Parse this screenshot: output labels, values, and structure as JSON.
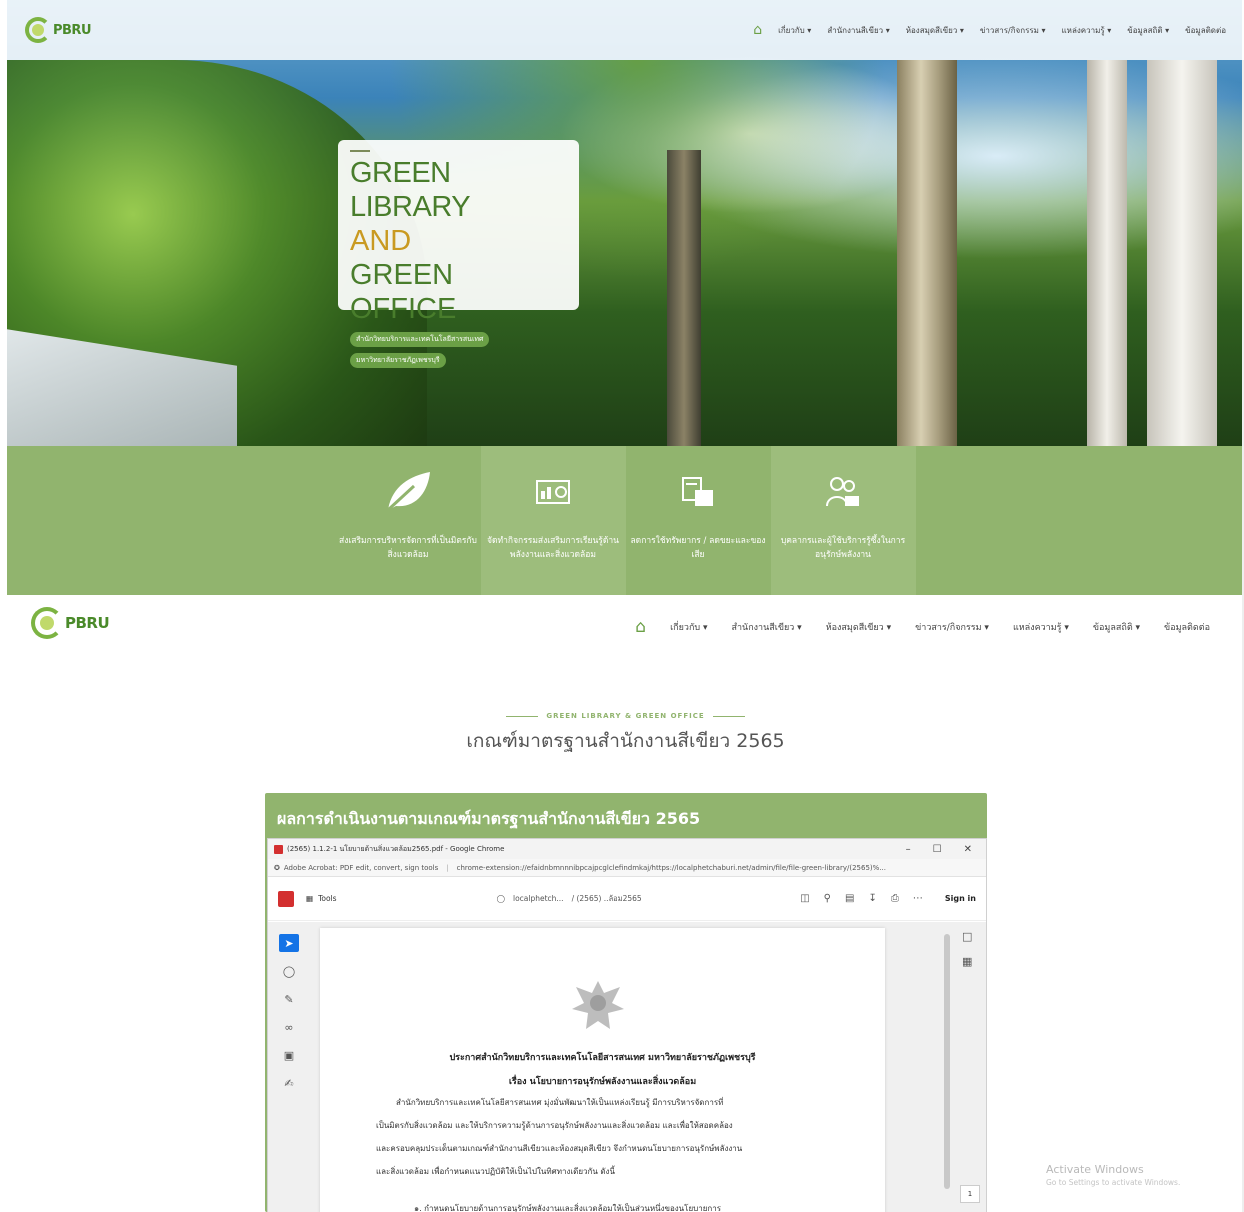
{
  "brand": {
    "logo_text": "PBRU"
  },
  "nav": {
    "items": [
      "เกี่ยวกับ ▾",
      "สำนักงานสีเขียว ▾",
      "ห้องสมุดสีเขียว ▾",
      "ข่าวสาร/กิจกรรม ▾",
      "แหล่งความรู้ ▾",
      "ข้อมูลสถิติ ▾",
      "ข้อมูลติดต่อ"
    ]
  },
  "hero": {
    "line1": "GREEN LIBRARY",
    "line2": "AND",
    "line3": "GREEN OFFICE",
    "pill1": "สำนักวิทยบริการและเทคโนโลยีสารสนเทศ",
    "pill2": "มหาวิทยาลัยราชภัฏเพชรบุรี"
  },
  "features": [
    {
      "icon": "leaf-icon",
      "label": "ส่งเสริมการบริหารจัดการที่เป็นมิตรกับสิ่งแวดล้อม"
    },
    {
      "icon": "activity-board-icon",
      "label": "จัดทำกิจกรรมส่งเสริมการเรียนรู้ด้านพลังงานและสิ่งแวดล้อม"
    },
    {
      "icon": "resource-reduction-icon",
      "label": "ลดการใช้ทรัพยากร / ลดขยะและของเสีย"
    },
    {
      "icon": "people-icon",
      "label": "บุคลากรและผู้ใช้บริการรู้ซึ้งในการอนุรักษ์พลังงาน"
    }
  ],
  "section": {
    "eyebrow": "GREEN LIBRARY & GREEN OFFICE",
    "title": "เกณฑ์มาตรฐานสำนักงานสีเขียว 2565"
  },
  "panel": {
    "title": "ผลการดำเนินงานตามเกณฑ์มาตรฐานสำนักงานสีเขียว 2565"
  },
  "chrome": {
    "window_title": "(2565) 1.1.2-1 นโยบายด้านสิ่งแวดล้อม2565.pdf - Google Chrome",
    "ext_name": "Adobe Acrobat: PDF edit, convert, sign tools",
    "url": "chrome-extension://efaidnbmnnnibpcajpcglclefindmkaj/https://localphetchaburi.net/admin/file/file-green-library/(2565)%...",
    "tools_label": "Tools",
    "host": "localphetch...",
    "file_short": "/  (2565) ..ล้อม2565",
    "sign_in": "Sign in",
    "page_number": "1"
  },
  "doc": {
    "heading": "ประกาศสำนักวิทยบริการและเทคโนโลยีสารสนเทศ มหาวิทยาลัยราชภัฏเพชรบุรี",
    "subject": "เรื่อง นโยบายการอนุรักษ์พลังงานและสิ่งแวดล้อม",
    "p1": "สำนักวิทยบริการและเทคโนโลยีสารสนเทศ มุ่งมั่นพัฒนาให้เป็นแหล่งเรียนรู้ มีการบริหารจัดการที่",
    "p2": "เป็นมิตรกับสิ่งแวดล้อม และให้บริการความรู้ด้านการอนุรักษ์พลังงานและสิ่งแวดล้อม และเพื่อให้สอดคล้อง",
    "p3": "และครอบคลุมประเด็นตามเกณฑ์สำนักงานสีเขียวและห้องสมุดสีเขียว จึงกำหนดนโยบายการอนุรักษ์พลังงาน",
    "p4": "และสิ่งแวดล้อม เพื่อกำหนดแนวปฏิบัติให้เป็นไปในทิศทางเดียวกัน ดังนี้",
    "p5": "๑. กำหนดนโยบายด้านการอนุรักษ์พลังงานและสิ่งแวดล้อมให้เป็นส่วนหนึ่งของนโยบายการ"
  },
  "watermark": {
    "title": "Activate Windows",
    "sub": "Go to Settings to activate Windows."
  }
}
